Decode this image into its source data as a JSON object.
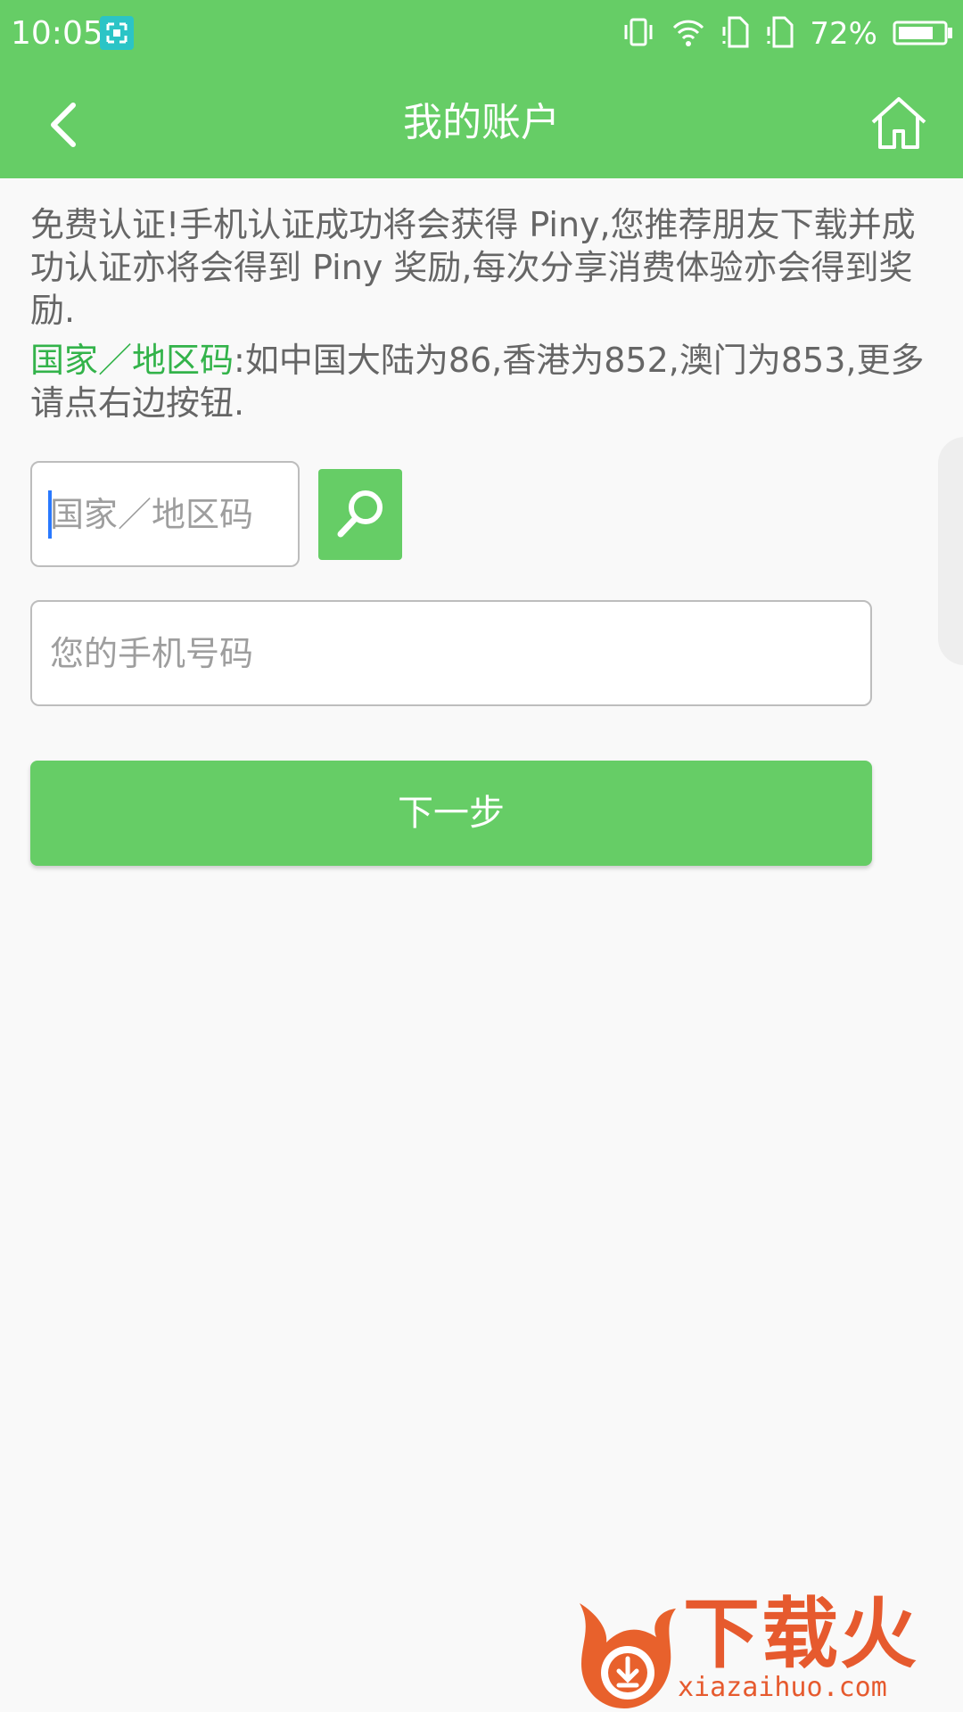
{
  "status_bar": {
    "time": "10:05",
    "battery": "72%"
  },
  "toolbar": {
    "title": "我的账户"
  },
  "intro": {
    "description": "免费认证!手机认证成功将会获得 Piny,您推荐朋友下载并成功认证亦将会得到 Piny 奖励,每次分享消费体验亦会得到奖励.",
    "hint_highlight": "国家／地区码",
    "hint_rest": ":如中国大陆为86,香港为852,澳门为853,更多请点右边按钮."
  },
  "form": {
    "country_placeholder": "国家／地区码",
    "phone_placeholder": "您的手机号码",
    "next_label": "下一步"
  },
  "watermark": {
    "title": "下载火",
    "domain": "xiazaihuo.com"
  },
  "colors": {
    "primary": "#66cd66",
    "highlight": "#33b34a",
    "text": "#666666",
    "background": "#f9f9f9"
  }
}
